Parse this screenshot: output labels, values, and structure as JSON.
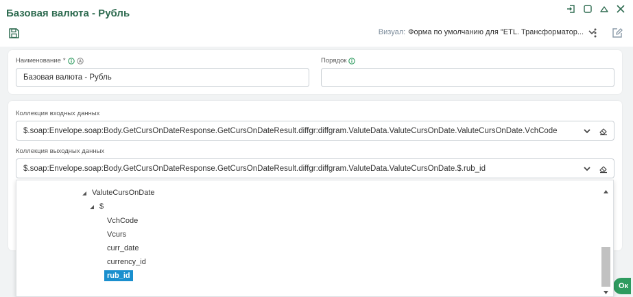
{
  "window": {
    "title": "Базовая валюта - Рубль"
  },
  "toolbar": {
    "visual_label": "Визуал:",
    "visual_value": "Форма по умолчанию для \"ETL. Трансформатор..."
  },
  "form": {
    "name": {
      "label": "Наименование",
      "required_mark": "*",
      "value": "Базовая валюта - Рубль"
    },
    "order": {
      "label": "Порядок",
      "value": ""
    },
    "input_collection": {
      "label": "Коллекция входных данных",
      "value": "$.soap:Envelope.soap:Body.GetCursOnDateResponse.GetCursOnDateResult.diffgr:diffgram.ValuteData.ValuteCursOnDate.ValuteCursOnDate.VchCode"
    },
    "output_collection": {
      "label": "Коллекция выходных данных",
      "value": "$.soap:Envelope.soap:Body.GetCursOnDateResponse.GetCursOnDateResult.diffgr:diffgram.ValuteData.ValuteCursOnDate.$.rub_id"
    }
  },
  "tree": {
    "items": [
      {
        "label": "ValuteCursOnDate"
      },
      {
        "label": "$"
      },
      {
        "label": "VchCode"
      },
      {
        "label": "Vcurs"
      },
      {
        "label": "curr_date"
      },
      {
        "label": "currency_id"
      },
      {
        "label": "rub_id",
        "selected": true
      }
    ],
    "scroll_position": 0.6
  },
  "footer": {
    "ok_label": "Ок"
  },
  "colors": {
    "accent": "#2e6b50",
    "selection": "#1a8fce",
    "ok_button": "#2e9b5f",
    "background": "#f1f3f4"
  }
}
